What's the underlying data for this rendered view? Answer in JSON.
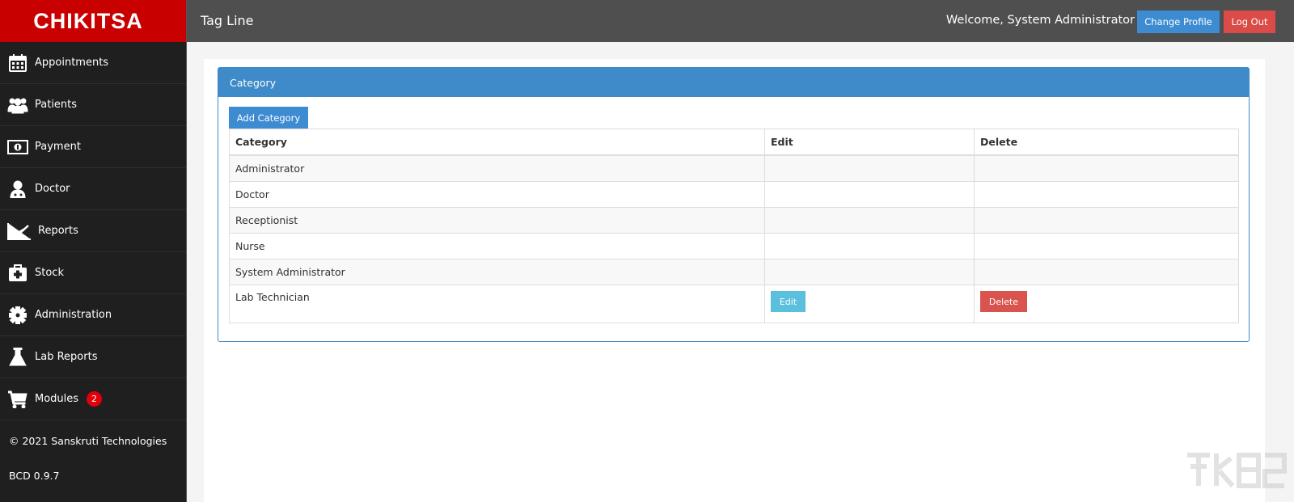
{
  "brand": "CHIKITSA",
  "nav": [
    {
      "label": "Appointments",
      "icon": "calendar-icon"
    },
    {
      "label": "Patients",
      "icon": "users-icon"
    },
    {
      "label": "Payment",
      "icon": "money-icon"
    },
    {
      "label": "Doctor",
      "icon": "doctor-icon"
    },
    {
      "label": "Reports",
      "icon": "line-chart-icon"
    },
    {
      "label": "Stock",
      "icon": "medkit-icon"
    },
    {
      "label": "Administration",
      "icon": "gear-icon"
    },
    {
      "label": "Lab Reports",
      "icon": "flask-icon"
    },
    {
      "label": "Modules",
      "icon": "cart-icon",
      "badge": "2"
    }
  ],
  "footer": {
    "copyright": "© 2021 Sanskruti Technologies",
    "version": "BCD 0.9.7"
  },
  "topbar": {
    "tagline": "Tag Line",
    "welcome": "Welcome, System Administrator",
    "change_profile": "Change Profile",
    "logout": "Log Out"
  },
  "panel": {
    "title": "Category",
    "add_button": "Add Category",
    "columns": [
      "Category",
      "Edit",
      "Delete"
    ],
    "rows": [
      {
        "category": "Administrator"
      },
      {
        "category": "Doctor"
      },
      {
        "category": "Receptionist"
      },
      {
        "category": "Nurse"
      },
      {
        "category": "System Administrator"
      },
      {
        "category": "Lab Technician",
        "edit": "Edit",
        "delete": "Delete"
      }
    ]
  },
  "colors": {
    "brand": "#c90000",
    "sidebar": "#1f1f1f",
    "topbar": "#4f4f4f",
    "primary": "#3d8bd1",
    "danger": "#d9534f",
    "info": "#5bc0de",
    "badge": "#e0000a"
  }
}
